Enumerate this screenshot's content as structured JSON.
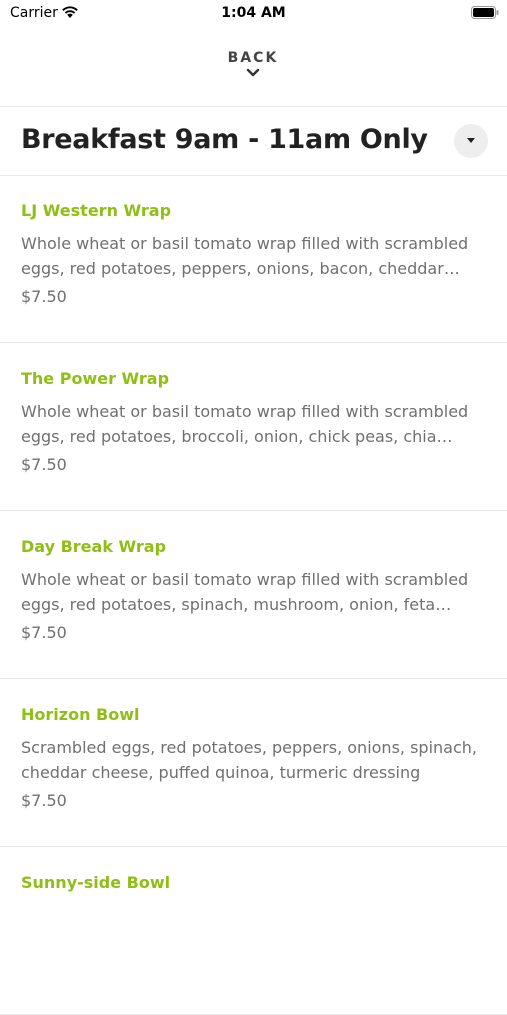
{
  "status_bar": {
    "carrier": "Carrier",
    "time": "1:04 AM"
  },
  "nav": {
    "back_label": "BACK"
  },
  "section": {
    "title": "Breakfast 9am - 11am Only"
  },
  "colors": {
    "accent": "#8fbf14",
    "text_secondary": "#707070",
    "divider": "#e8e8e8"
  },
  "menu_items": [
    {
      "name": "LJ Western Wrap",
      "description": "Whole wheat or basil tomato wrap filled with scrambled eggs, red potatoes, peppers, onions, bacon, cheddar che…",
      "price": "$7.50"
    },
    {
      "name": "The Power Wrap",
      "description": "Whole wheat or basil tomato wrap filled with scrambled eggs, red potatoes, broccoli, onion, chick peas, chia seed…",
      "price": "$7.50"
    },
    {
      "name": "Day Break Wrap",
      "description": "Whole wheat or basil tomato wrap filled with scrambled eggs, red potatoes, spinach, mushroom, onion, feta cheese",
      "price": "$7.50"
    },
    {
      "name": "Horizon Bowl",
      "description": "Scrambled eggs, red potatoes, peppers, onions, spinach, cheddar cheese, puffed quinoa, turmeric dressing",
      "price": "$7.50"
    },
    {
      "name": "Sunny-side Bowl",
      "description": "",
      "price": ""
    }
  ]
}
